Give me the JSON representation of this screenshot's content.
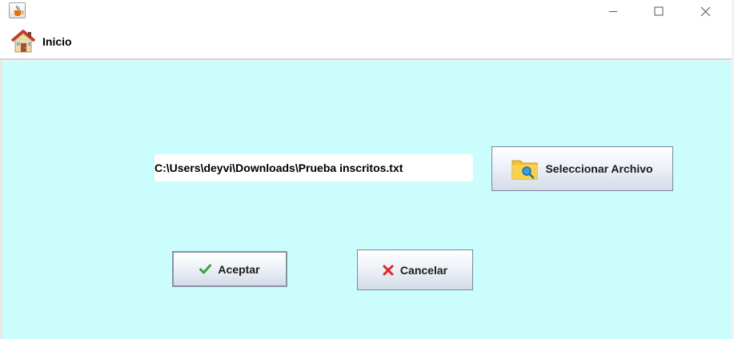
{
  "window": {
    "title": ""
  },
  "menubar": {
    "inicio_label": "Inicio"
  },
  "form": {
    "file_path": "C:\\Users\\deyvi\\Downloads\\Prueba inscritos.txt",
    "select_file_label": "Seleccionar Archivo",
    "accept_label": "Aceptar",
    "cancel_label": "Cancelar"
  },
  "colors": {
    "panel_background": "#ccfdfd",
    "accept_check": "#3aa53a",
    "cancel_x": "#e02424",
    "folder": "#f2c230"
  },
  "icons": {
    "app": "java-cup-icon",
    "home": "house-icon",
    "select_file": "folder-search-icon",
    "accept": "check-icon",
    "cancel": "x-icon",
    "minimize": "minimize-icon",
    "maximize": "maximize-icon",
    "close": "close-icon"
  }
}
